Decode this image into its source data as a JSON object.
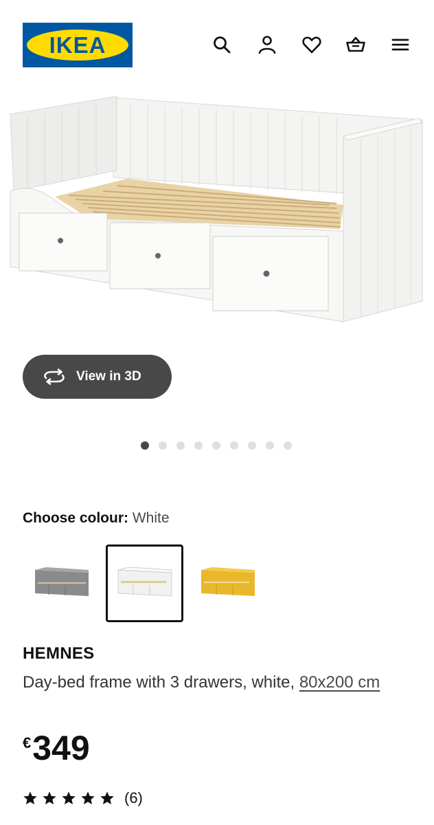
{
  "header": {
    "logo_text": "IKEA",
    "icons": [
      "search-icon",
      "account-icon",
      "heart-icon",
      "basket-icon",
      "menu-icon"
    ]
  },
  "media": {
    "view_3d_label": "View in 3D",
    "carousel_total": 9,
    "carousel_active": 1
  },
  "colour": {
    "label": "Choose colour:",
    "selected": "White",
    "swatches": [
      {
        "name": "grey",
        "color": "#8a8b8d"
      },
      {
        "name": "white",
        "color": "#f1f1ef"
      },
      {
        "name": "yellow",
        "color": "#e9b82a"
      }
    ]
  },
  "product": {
    "name": "HEMNES",
    "description": "Day-bed frame with 3 drawers, white,",
    "size": "80x200 cm",
    "currency": "€",
    "price": "349",
    "rating_stars": 5,
    "review_count": "(6)"
  },
  "colors": {
    "brand_blue": "#0058a3",
    "brand_yellow": "#ffdb00",
    "button_dark": "#484848"
  }
}
